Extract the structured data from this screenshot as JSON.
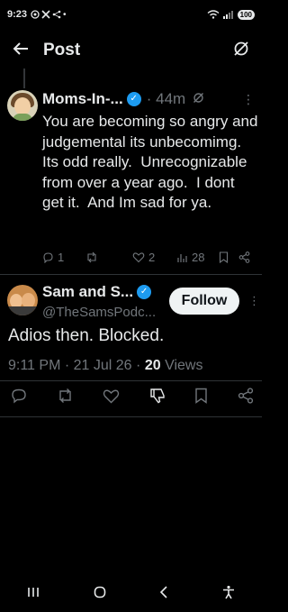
{
  "status_bar": {
    "time": "9:23",
    "battery": "100"
  },
  "header": {
    "title": "Post"
  },
  "reply_tweet": {
    "display_name": "Moms-In-...",
    "time": "44m",
    "text": "You are becoming so angry and judgemental its unbecomimg.  Its odd really.  Unrecognizable from over a year ago.  I dont get it.  And Im sad for ya.",
    "replies": "1",
    "likes": "2",
    "views": "28"
  },
  "main_tweet": {
    "display_name": "Sam and S...",
    "handle": "@TheSamsPodc...",
    "follow_label": "Follow",
    "text": "Adios then. Blocked.",
    "time": "9:11 PM",
    "date": "21 Jul 26",
    "views_count": "20",
    "views_label": "Views"
  },
  "colors": {
    "background": "#000000",
    "text": "#e7e9ea",
    "muted": "#71767b",
    "verified": "#1d9bf0",
    "divider": "#2f3336"
  }
}
